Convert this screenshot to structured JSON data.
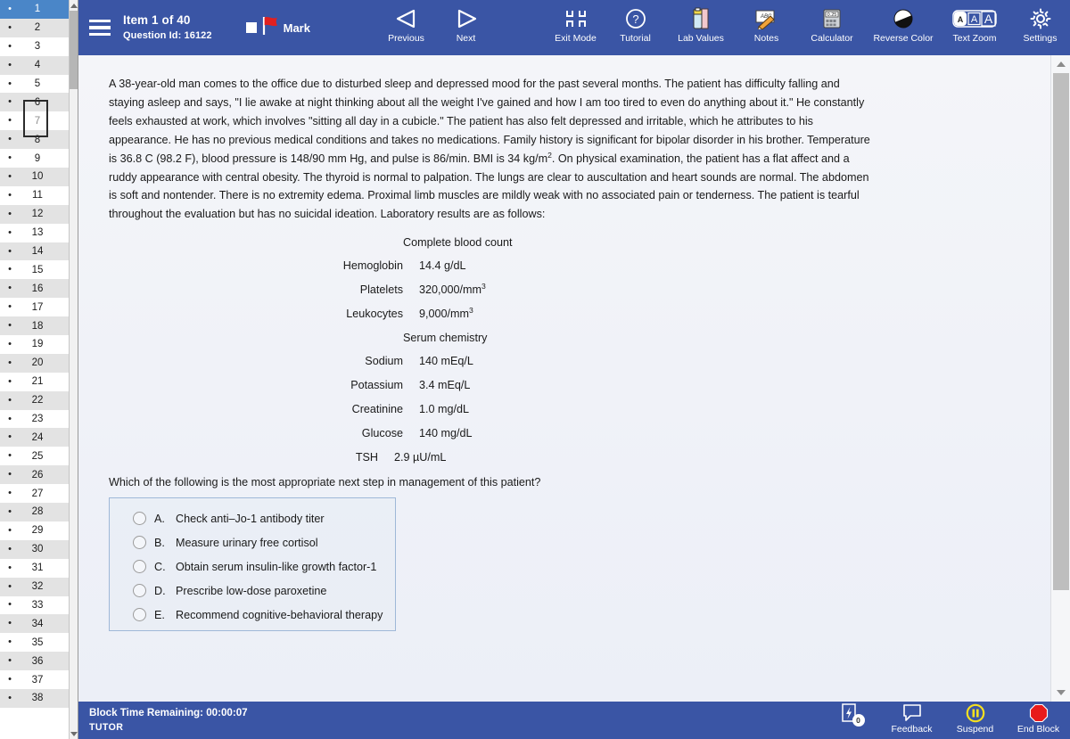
{
  "sidebar": {
    "items": [
      {
        "num": "1",
        "selected": true
      },
      {
        "num": "2"
      },
      {
        "num": "3"
      },
      {
        "num": "4"
      },
      {
        "num": "5"
      },
      {
        "num": "6"
      },
      {
        "num": "7"
      },
      {
        "num": "8"
      },
      {
        "num": "9"
      },
      {
        "num": "10"
      },
      {
        "num": "11"
      },
      {
        "num": "12"
      },
      {
        "num": "13"
      },
      {
        "num": "14"
      },
      {
        "num": "15"
      },
      {
        "num": "16"
      },
      {
        "num": "17"
      },
      {
        "num": "18"
      },
      {
        "num": "19"
      },
      {
        "num": "20"
      },
      {
        "num": "21"
      },
      {
        "num": "22"
      },
      {
        "num": "23"
      },
      {
        "num": "24"
      },
      {
        "num": "25"
      },
      {
        "num": "26"
      },
      {
        "num": "27"
      },
      {
        "num": "28"
      },
      {
        "num": "29"
      },
      {
        "num": "30"
      },
      {
        "num": "31"
      },
      {
        "num": "32"
      },
      {
        "num": "33"
      },
      {
        "num": "34"
      },
      {
        "num": "35"
      },
      {
        "num": "36"
      },
      {
        "num": "37"
      },
      {
        "num": "38"
      }
    ],
    "bullet": "•"
  },
  "header": {
    "item_counter": "Item 1 of 40",
    "question_id": "Question Id: 16122",
    "mark_label": "Mark",
    "buttons": [
      {
        "key": "previous",
        "label": "Previous",
        "icon": "triangle-left-icon"
      },
      {
        "key": "next",
        "label": "Next",
        "icon": "triangle-right-icon"
      },
      {
        "key": "exit_mode",
        "label": "Exit Mode",
        "icon": "contract-arrows-icon"
      },
      {
        "key": "tutorial",
        "label": "Tutorial",
        "icon": "question-mark-circle-icon"
      },
      {
        "key": "lab_values",
        "label": "Lab Values",
        "icon": "test-tube-icon"
      },
      {
        "key": "notes",
        "label": "Notes",
        "icon": "pencil-note-icon"
      },
      {
        "key": "calculator",
        "label": "Calculator",
        "icon": "calculator-icon"
      },
      {
        "key": "reverse_color",
        "label": "Reverse Color",
        "icon": "half-circle-icon"
      },
      {
        "key": "text_zoom",
        "label": "Text Zoom",
        "icon": "text-size-icon"
      },
      {
        "key": "settings",
        "label": "Settings",
        "icon": "gear-icon"
      }
    ],
    "text_zoom_sizes": [
      "A",
      "A",
      "A"
    ],
    "calculator_display": "0.25",
    "notes_scribble": "ABC"
  },
  "question": {
    "stem_runs": [
      {
        "t": "A 38-year-old man comes to the office due to disturbed sleep and depressed mood for the past several months.  The patient has difficulty falling and staying asleep and says, \"I lie awake at night thinking about all the weight I've gained and how I am too tired to even do anything about it.\"  He constantly feels exhausted at work, which involves \"sitting all day in a cubicle.\"  The patient has also felt depressed and irritable, which he attributes to his appearance.  He has no previous medical conditions and takes no medications.  Family history is significant for bipolar disorder in his brother.  Temperature is 36.8 C (98.2 F), blood pressure is 148/90 mm Hg, and pulse is 86/min.  BMI is 34 kg/m"
      },
      {
        "t": "2",
        "sup": true
      },
      {
        "t": ".  On physical examination, the patient has a flat affect and a ruddy appearance with central obesity.  The thyroid is normal to palpation.  The lungs are clear to auscultation and heart sounds are normal.  The abdomen is soft and nontender.  There is no extremity edema.  Proximal limb muscles are mildly weak with no associated pain or tenderness.  The patient is tearful throughout the evaluation but has no suicidal ideation.  Laboratory results are as follows:"
      }
    ],
    "lab_groups": [
      {
        "heading": "Complete blood count",
        "rows": [
          {
            "name": "Hemoglobin",
            "value": "14.4 g/dL"
          },
          {
            "name": "Platelets",
            "value": "320,000/mm",
            "sup": "3"
          },
          {
            "name": "Leukocytes",
            "value": "9,000/mm",
            "sup": "3"
          }
        ]
      },
      {
        "heading": "Serum chemistry",
        "rows": [
          {
            "name": "Sodium",
            "value": "140 mEq/L"
          },
          {
            "name": "Potassium",
            "value": "3.4 mEq/L"
          },
          {
            "name": "Creatinine",
            "value": "1.0 mg/dL"
          },
          {
            "name": "Glucose",
            "value": "140 mg/dL"
          }
        ]
      }
    ],
    "standalone_labs": [
      {
        "name": "TSH",
        "value": "2.9 µU/mL"
      }
    ],
    "lead_in": "Which of the following is the most appropriate next step in management of this patient?",
    "options": [
      {
        "letter": "A.",
        "text": "Check anti–Jo-1 antibody titer"
      },
      {
        "letter": "B.",
        "text": "Measure urinary free cortisol"
      },
      {
        "letter": "C.",
        "text": "Obtain serum insulin-like growth factor-1"
      },
      {
        "letter": "D.",
        "text": "Prescribe low-dose paroxetine"
      },
      {
        "letter": "E.",
        "text": "Recommend cognitive-behavioral therapy"
      }
    ]
  },
  "footer": {
    "block_time": "Block Time Remaining: 00:00:07",
    "mode": "TUTOR",
    "buttons": [
      {
        "key": "flash",
        "label": "",
        "icon": "flash-card-icon",
        "badge": "0"
      },
      {
        "key": "feedback",
        "label": "Feedback",
        "icon": "speech-bubble-icon"
      },
      {
        "key": "suspend",
        "label": "Suspend",
        "icon": "pause-circle-icon"
      },
      {
        "key": "end_block",
        "label": "End Block",
        "icon": "stop-octagon-icon"
      }
    ]
  },
  "colors": {
    "brand_blue": "#3a55a5",
    "sidebar_selected": "#4a86c8",
    "flag_red": "#e02020",
    "suspend_yellow": "#f5e020",
    "stop_red": "#e81b1b",
    "option_border": "#9fb8d8"
  }
}
